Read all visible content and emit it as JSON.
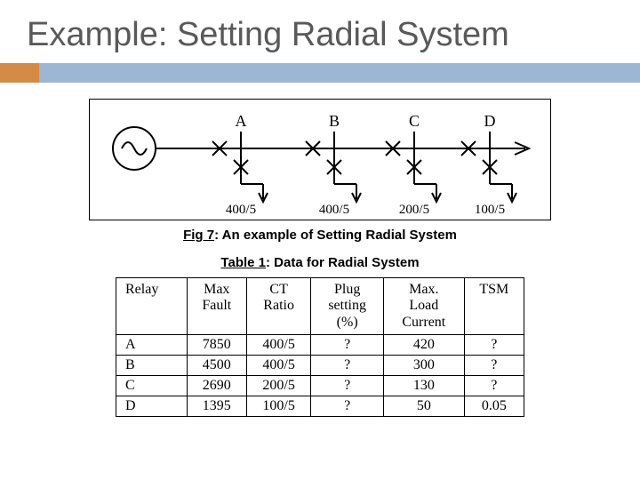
{
  "title": "Example: Setting Radial System",
  "figure": {
    "caption_label": "Fig 7",
    "caption_text": ": An example of Setting Radial System",
    "nodes": [
      {
        "label": "A",
        "ct": "400/5"
      },
      {
        "label": "B",
        "ct": "400/5"
      },
      {
        "label": "C",
        "ct": "200/5"
      },
      {
        "label": "D",
        "ct": "100/5"
      }
    ]
  },
  "table": {
    "caption_label": "Table 1",
    "caption_text": ": Data for Radial System",
    "headers": [
      "Relay",
      "Max\nFault",
      "CT\nRatio",
      "Plug\nsetting\n(%)",
      "Max.\nLoad\nCurrent",
      "TSM"
    ],
    "rows": [
      {
        "relay": "A",
        "max_fault": "7850",
        "ct_ratio": "400/5",
        "plug": "?",
        "max_load": "420",
        "tsm": "?"
      },
      {
        "relay": "B",
        "max_fault": "4500",
        "ct_ratio": "400/5",
        "plug": "?",
        "max_load": "300",
        "tsm": "?"
      },
      {
        "relay": "C",
        "max_fault": "2690",
        "ct_ratio": "200/5",
        "plug": "?",
        "max_load": "130",
        "tsm": "?"
      },
      {
        "relay": "D",
        "max_fault": "1395",
        "ct_ratio": "100/5",
        "plug": "?",
        "max_load": "50",
        "tsm": "0.05"
      }
    ]
  }
}
